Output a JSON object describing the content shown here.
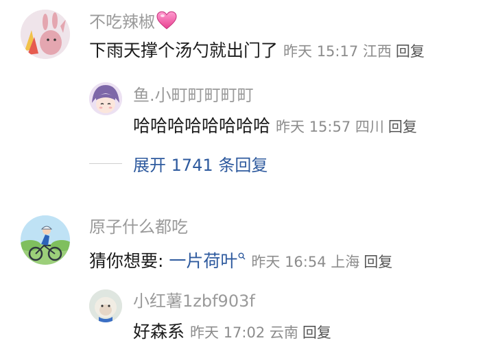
{
  "comments": [
    {
      "username": "不吃辣椒",
      "content": "下雨天撑个汤勺就出门了",
      "time": "昨天 15:17",
      "location": "江西",
      "reply": "回复",
      "replies": [
        {
          "username": "鱼.小町町町町町",
          "content": "哈哈哈哈哈哈哈哈",
          "time": "昨天 15:57",
          "location": "四川",
          "reply": "回复"
        }
      ],
      "expand": "展开 1741 条回复"
    },
    {
      "username": "原子什么都吃",
      "content_prefix": "猜你想要: ",
      "content_link": "一片荷叶",
      "time": "昨天 16:54",
      "location": "上海",
      "reply": "回复",
      "replies": [
        {
          "username": "小红薯1zbf903f",
          "content": "好森系",
          "time": "昨天 17:02",
          "location": "云南",
          "reply": "回复"
        }
      ]
    }
  ],
  "colors": {
    "username": "#9a9a9a",
    "link": "#2e5a9e",
    "meta": "#8c8c8c",
    "heart": "#f06aa6"
  },
  "icons": {
    "heart": "heart-icon",
    "search": "search-icon"
  }
}
